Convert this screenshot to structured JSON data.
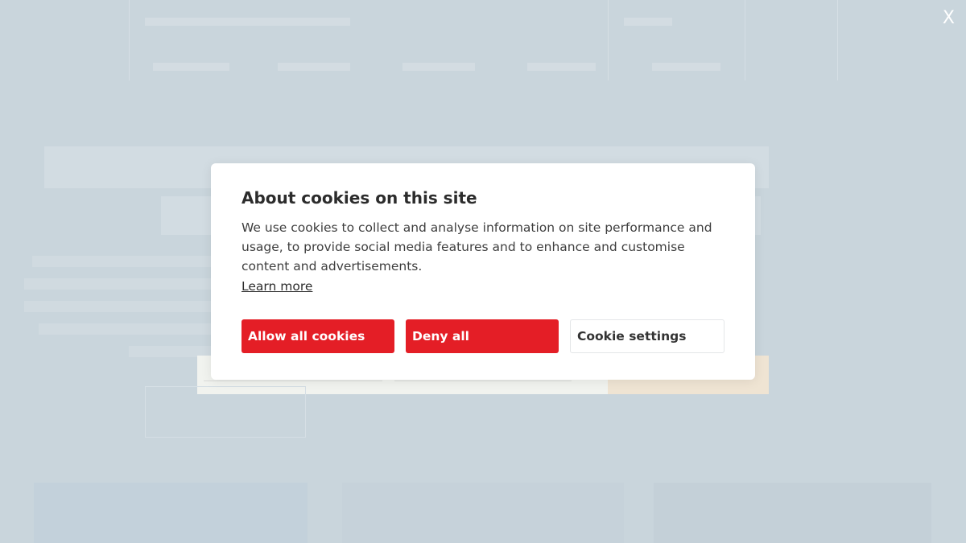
{
  "modal": {
    "title": "About cookies on this site",
    "body": "We use cookies to collect and analyse information on site performance and usage, to provide social media features and to enhance and customise content and advertisements.",
    "learn_more": "Learn more",
    "buttons": {
      "allow": "Allow all cookies",
      "deny": "Deny all",
      "settings": "Cookie settings"
    }
  },
  "close_label": "X",
  "colors": {
    "primary_red": "#e41e26",
    "overlay": "#cfdae0"
  }
}
